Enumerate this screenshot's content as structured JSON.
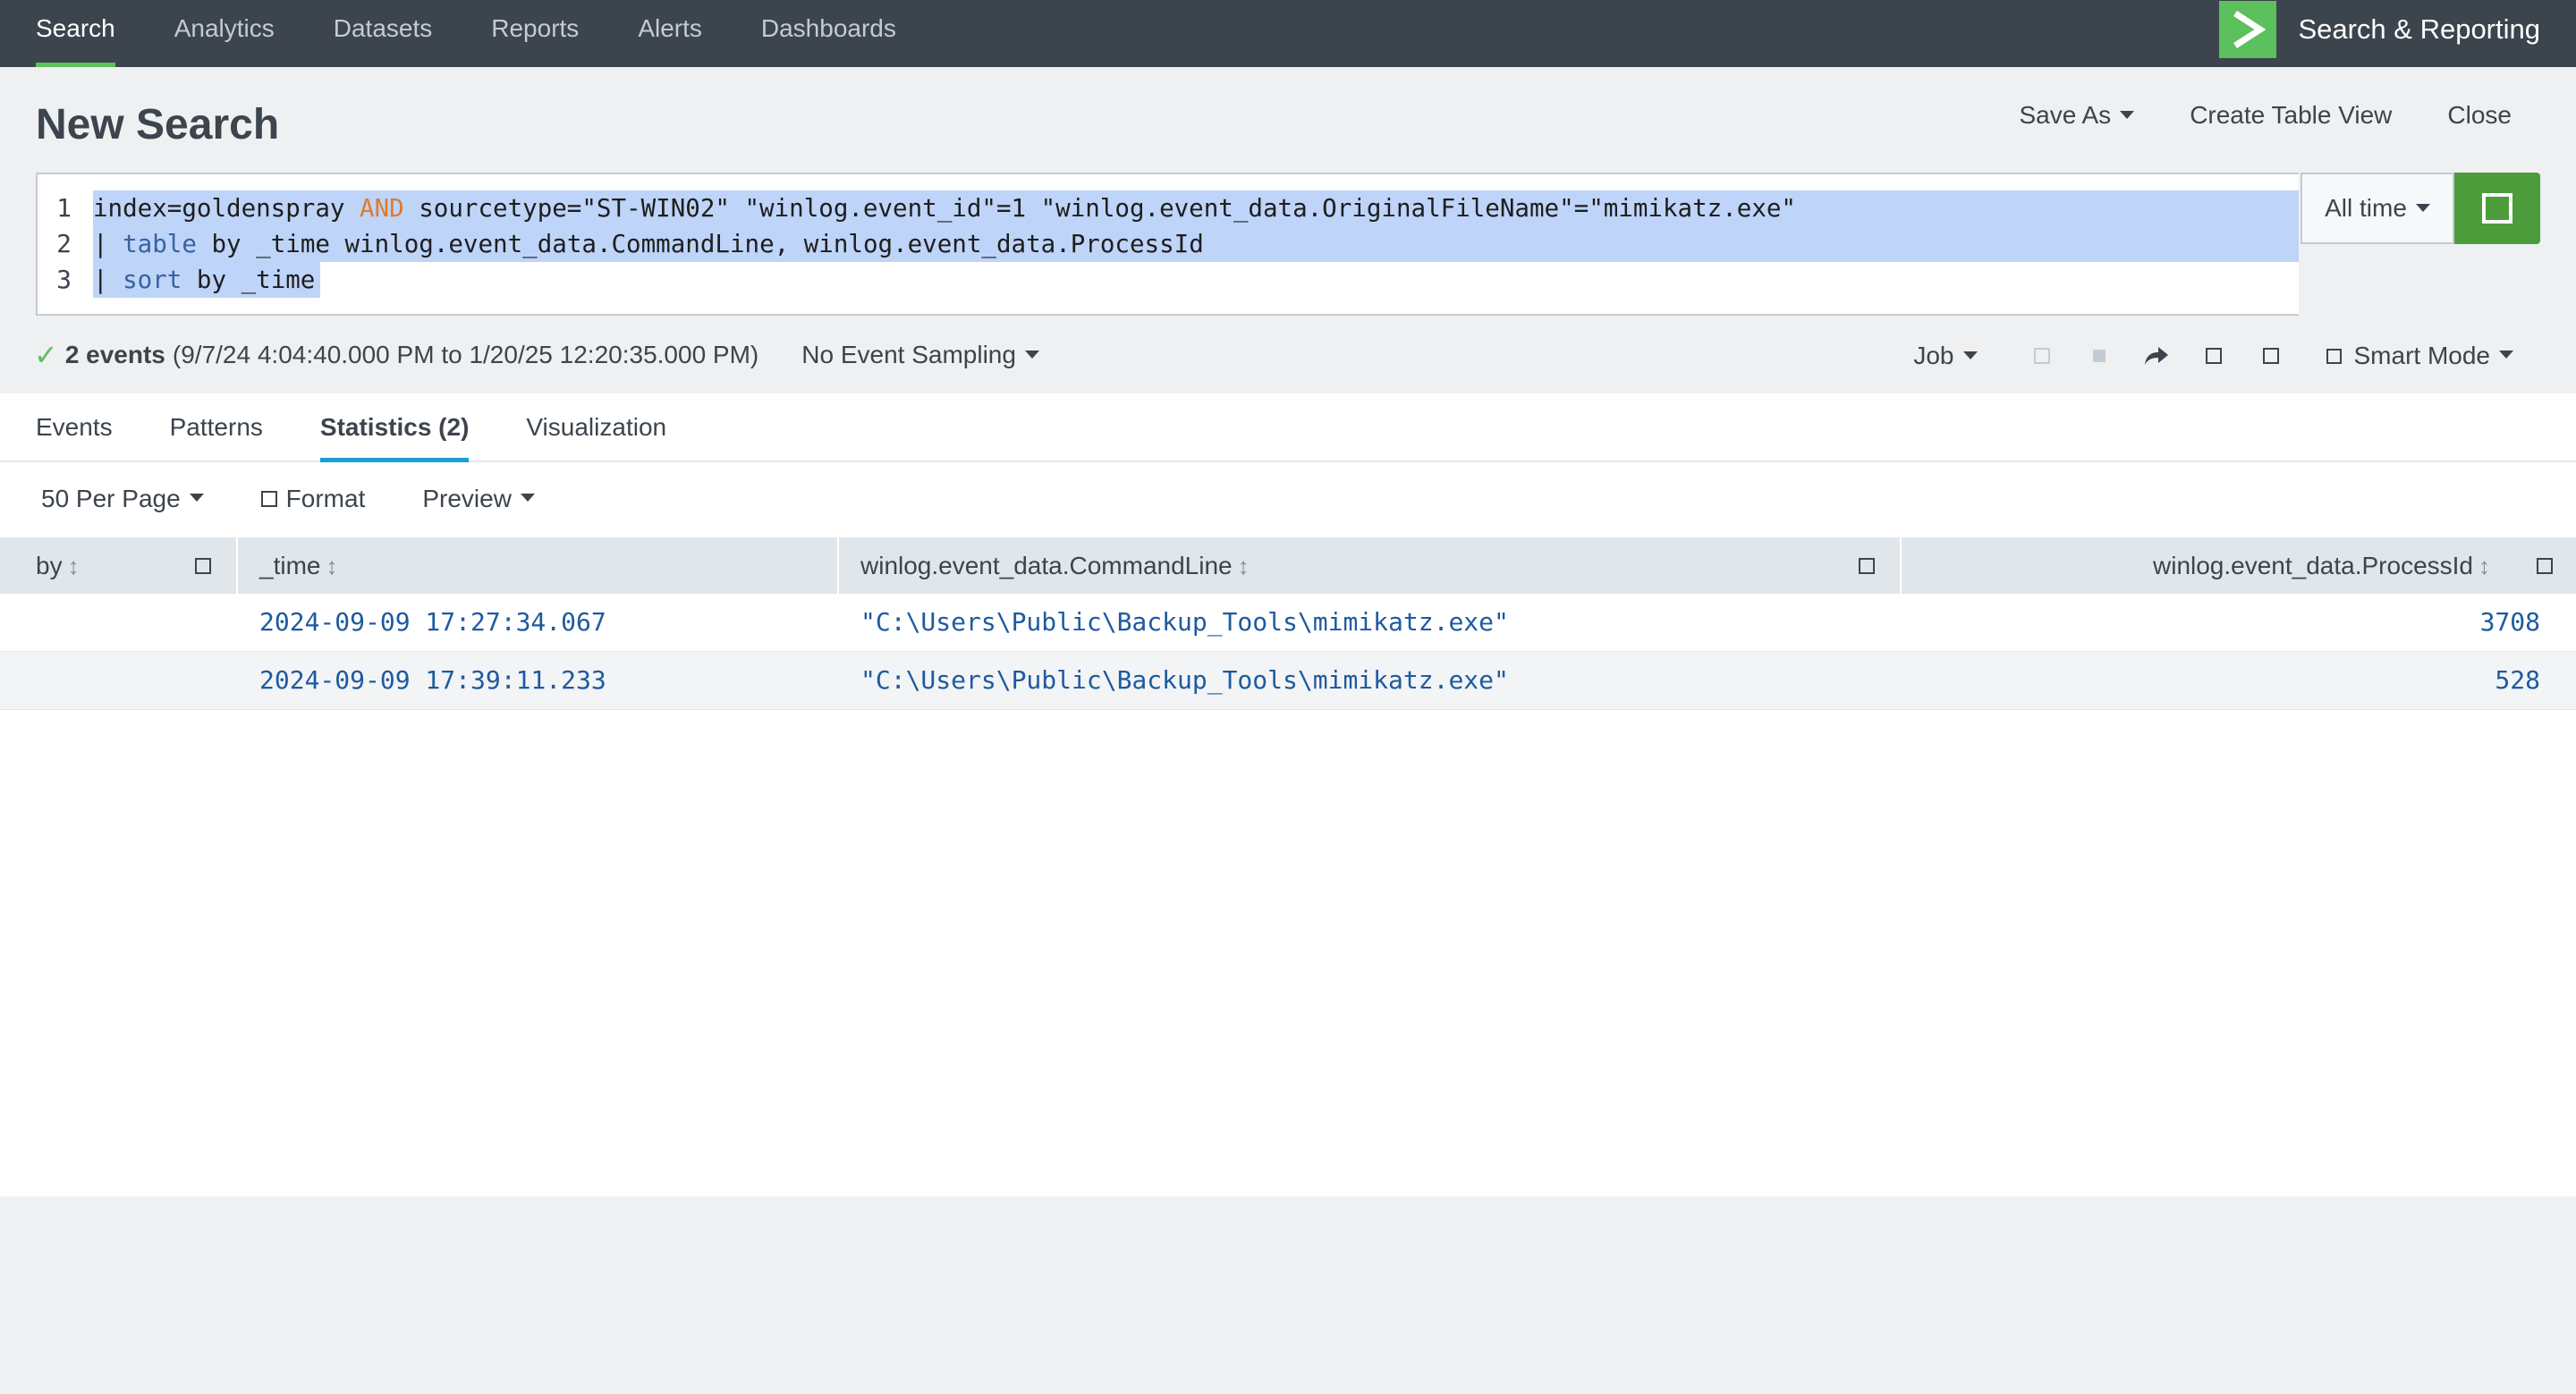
{
  "appbar": {
    "nav": [
      "Search",
      "Analytics",
      "Datasets",
      "Reports",
      "Alerts",
      "Dashboards"
    ],
    "active": "Search",
    "app_name": "Search & Reporting"
  },
  "page": {
    "title": "New Search",
    "actions": {
      "save_as": "Save As",
      "create_table_view": "Create Table View",
      "close": "Close"
    }
  },
  "query": {
    "line_numbers": [
      "1",
      "2",
      "3"
    ],
    "line1": {
      "a": "index=goldenspray ",
      "kw": "AND",
      "b": " sourcetype=\"ST-WIN02\" \"winlog.event_id\"=1 \"winlog.event_data.OriginalFileName\"=\"mimikatz.exe\""
    },
    "line2": {
      "pipe": "| ",
      "kw": "table",
      "b": " by _time winlog.event_data.CommandLine, winlog.event_data.ProcessId"
    },
    "line3": {
      "pipe": "| ",
      "kw": "sort",
      "b": " by _time"
    },
    "time_range": "All time"
  },
  "status": {
    "check": "✓",
    "count": "2 events",
    "range": "(9/7/24 4:04:40.000 PM to 1/20/25 12:20:35.000 PM)",
    "sampling": "No Event Sampling",
    "job": "Job",
    "mode": "Smart Mode"
  },
  "tabs": [
    "Events",
    "Patterns",
    "Statistics (2)",
    "Visualization"
  ],
  "active_tab": "Statistics (2)",
  "tools": {
    "per_page": "50 Per Page",
    "format": "Format",
    "preview": "Preview"
  },
  "table": {
    "columns": [
      "by",
      "_time",
      "winlog.event_data.CommandLine",
      "winlog.event_data.ProcessId"
    ],
    "rows": [
      [
        "",
        "2024-09-09 17:27:34.067",
        "\"C:\\Users\\Public\\Backup_Tools\\mimikatz.exe\"",
        "3708"
      ],
      [
        "",
        "2024-09-09 17:39:11.233",
        "\"C:\\Users\\Public\\Backup_Tools\\mimikatz.exe\"",
        "528"
      ]
    ]
  },
  "colors": {
    "appbar": "#3c444d",
    "accent_green": "#5cc05c",
    "go_button": "#4d9c3b",
    "tab_underline": "#1a9dd9",
    "link_blue": "#1e5aa0"
  }
}
